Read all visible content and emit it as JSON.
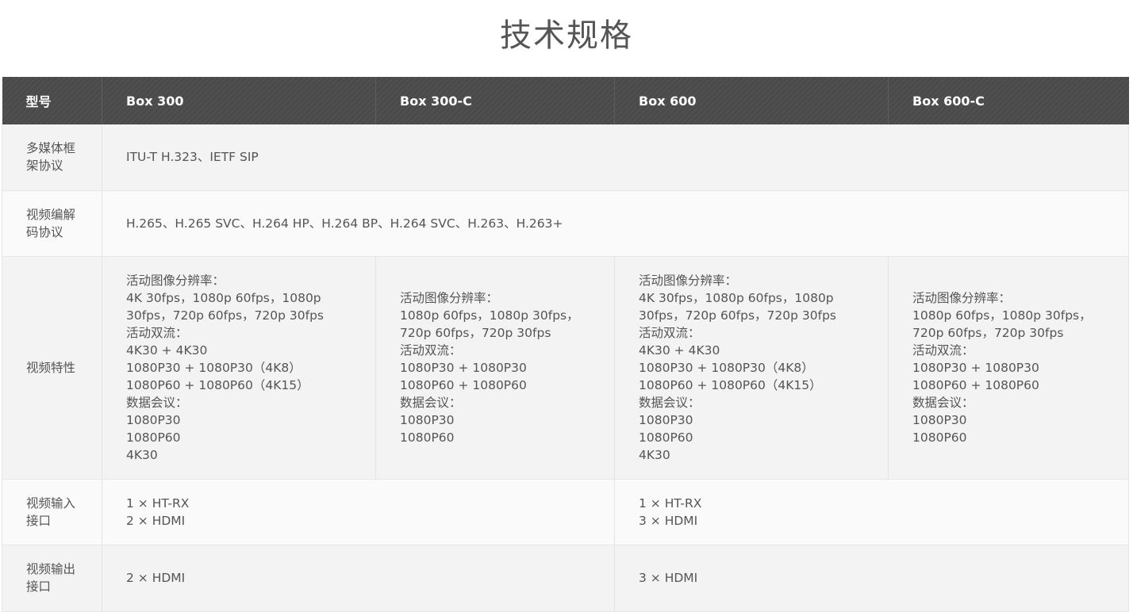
{
  "page": {
    "title": "技术规格"
  },
  "table": {
    "headers": [
      "型号",
      "Box 300",
      "Box 300-C",
      "Box 600",
      "Box 600-C"
    ],
    "rows": {
      "framework": {
        "label": "多媒体框架协议",
        "value": "ITU-T H.323、IETF SIP"
      },
      "codec": {
        "label": "视频编解码协议",
        "value": "H.265、H.265 SVC、H.264 HP、H.264 BP、H.264 SVC、H.263、H.263+"
      },
      "features": {
        "label": "视频特性",
        "box300": [
          "活动图像分辨率：",
          "4K 30fps，1080p 60fps，1080p",
          "30fps，720p 60fps，720p 30fps",
          "活动双流：",
          "4K30 + 4K30",
          "1080P30 + 1080P30（4K8）",
          "1080P60 + 1080P60（4K15）",
          "数据会议：",
          "1080P30",
          "1080P60",
          "4K30"
        ],
        "box300c": [
          "活动图像分辨率：",
          "1080p 60fps，1080p 30fps，",
          "720p 60fps，720p 30fps",
          "活动双流：",
          "1080P30 + 1080P30",
          "1080P60 + 1080P60",
          "数据会议：",
          "1080P30",
          "1080P60"
        ],
        "box600": [
          "活动图像分辨率：",
          "4K 30fps，1080p 60fps，1080p",
          "30fps，720p 60fps，720p 30fps",
          "活动双流：",
          "4K30 + 4K30",
          "1080P30 + 1080P30（4K8）",
          "1080P60 + 1080P60（4K15）",
          "数据会议：",
          "1080P30",
          "1080P60",
          "4K30"
        ],
        "box600c": [
          "活动图像分辨率：",
          "1080p 60fps，1080p 30fps，",
          "720p 60fps，720p 30fps",
          "活动双流：",
          "1080P30 + 1080P30",
          "1080P60 + 1080P60",
          "数据会议：",
          "1080P30",
          "1080P60"
        ]
      },
      "video_input": {
        "label": "视频输入接口",
        "box300_group": [
          "1 × HT-RX",
          "2 × HDMI"
        ],
        "box600_group": [
          "1 × HT-RX",
          "3 × HDMI"
        ]
      },
      "video_output": {
        "label": "视频输出接口",
        "box300_group": "2 × HDMI",
        "box600_group": "3 × HDMI"
      }
    }
  }
}
